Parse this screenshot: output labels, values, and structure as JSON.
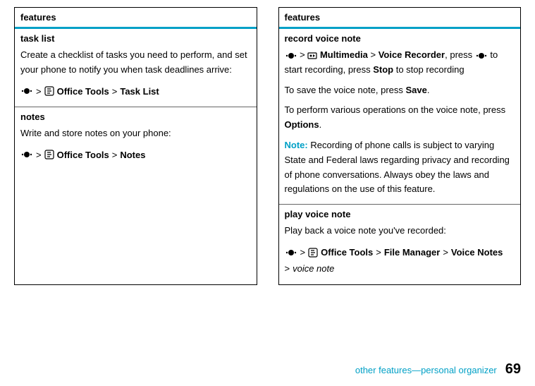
{
  "left": {
    "header": "features",
    "task_list": {
      "title": "task list",
      "desc": "Create a checklist of tasks you need to perform, and set your phone to notify you when task deadlines arrive:",
      "path": {
        "g1": " > ",
        "m1": "Office Tools",
        "g2": " > ",
        "m2": "Task List"
      }
    },
    "notes": {
      "title": "notes",
      "desc": "Write and store notes on your phone:",
      "path": {
        "g1": " > ",
        "m1": "Office Tools",
        "g2": " > ",
        "m2": "Notes"
      }
    }
  },
  "right": {
    "header": "features",
    "record": {
      "title": "record voice note",
      "path": {
        "g1": " > ",
        "m1": "Multimedia",
        "g2": " > ",
        "m2": "Voice Recorder",
        "tail1": ", press ",
        "tail2": " to start recording, press ",
        "stop": "Stop",
        "tail3": " to stop recording"
      },
      "save": {
        "pre": "To save the voice note, press ",
        "btn": "Save",
        "post": "."
      },
      "ops": {
        "pre": "To perform various operations on the voice note, press ",
        "btn": "Options",
        "post": "."
      },
      "note_label": "Note: ",
      "note_text": "Recording of phone calls is subject to varying State and Federal laws regarding privacy and recording of phone conversations. Always obey the laws and regulations on the use of this feature."
    },
    "play": {
      "title": "play voice note",
      "desc": "Play back a voice note you've recorded:",
      "path": {
        "g1": " > ",
        "m1": "Office Tools",
        "g2": " > ",
        "m2": "File Manager",
        "g3": " > ",
        "m3": "Voice Notes",
        "g4": "> ",
        "m4": "voice note"
      }
    }
  },
  "footer": {
    "text": "other features—personal organizer",
    "page": "69"
  }
}
